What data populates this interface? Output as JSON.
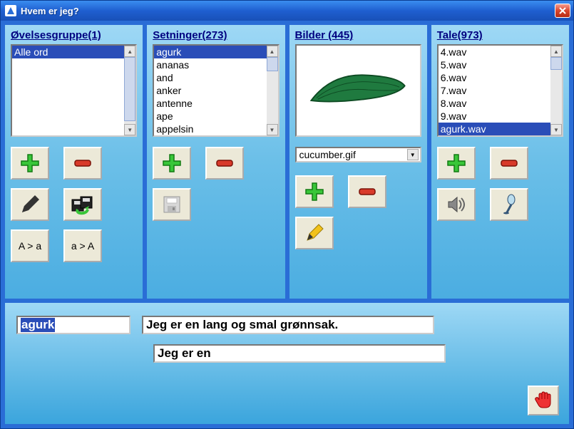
{
  "window": {
    "title": "Hvem er jeg?"
  },
  "panels": {
    "groups": {
      "title": "Øvelsesgruppe(1)",
      "items": [
        "Alle ord"
      ],
      "selected": 0
    },
    "sentences": {
      "title": "Setninger(273)",
      "items": [
        "agurk",
        "ananas",
        "and",
        "anker",
        "antenne",
        "ape",
        "appelsin"
      ],
      "selected": 0
    },
    "images": {
      "title": "Bilder (445)"
    },
    "speech": {
      "title": "Tale(973)",
      "items": [
        "4.wav",
        "5.wav",
        "6.wav",
        "7.wav",
        "8.wav",
        "9.wav",
        "agurk.wav"
      ],
      "selected": 6
    }
  },
  "image_dropdown": {
    "value": "cucumber.gif"
  },
  "case_buttons": {
    "to_lower": "A > a",
    "to_upper": "a > A"
  },
  "editor": {
    "word": "agurk",
    "sentence_full": "Jeg er en lang og smal grønnsak.",
    "sentence_partial": "Jeg er en"
  },
  "icons": {
    "add": "plus-icon",
    "remove": "minus-icon",
    "edit_pencil": "pencil-icon",
    "save_disks": "floppy-group-icon",
    "save_disk": "floppy-icon",
    "edit_yellow": "pencil-yellow-icon",
    "speaker": "speaker-icon",
    "microphone": "microphone-icon",
    "stop_hand": "hand-stop-icon"
  }
}
